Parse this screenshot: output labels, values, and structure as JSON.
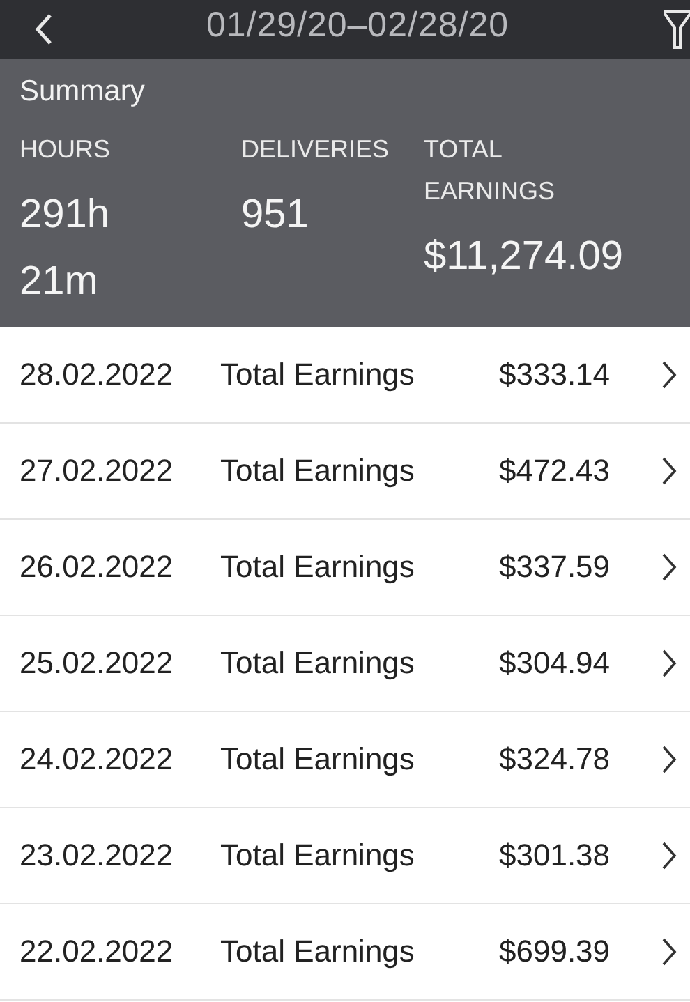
{
  "header": {
    "title": "01/29/20–02/28/20"
  },
  "summary": {
    "title": "Summary",
    "stats": [
      {
        "label": "HOURS",
        "value": "291h 21m"
      },
      {
        "label": "DELIVERIES",
        "value": "951"
      },
      {
        "label": "TOTAL EARNINGS",
        "value": "$11,274.09"
      }
    ]
  },
  "rows": [
    {
      "date": "28.02.2022",
      "label": "Total Earnings",
      "amount": "$333.14"
    },
    {
      "date": "27.02.2022",
      "label": "Total Earnings",
      "amount": "$472.43"
    },
    {
      "date": "26.02.2022",
      "label": "Total Earnings",
      "amount": "$337.59"
    },
    {
      "date": "25.02.2022",
      "label": "Total Earnings",
      "amount": "$304.94"
    },
    {
      "date": "24.02.2022",
      "label": "Total Earnings",
      "amount": "$324.78"
    },
    {
      "date": "23.02.2022",
      "label": "Total Earnings",
      "amount": "$301.38"
    },
    {
      "date": "22.02.2022",
      "label": "Total Earnings",
      "amount": "$699.39"
    }
  ]
}
